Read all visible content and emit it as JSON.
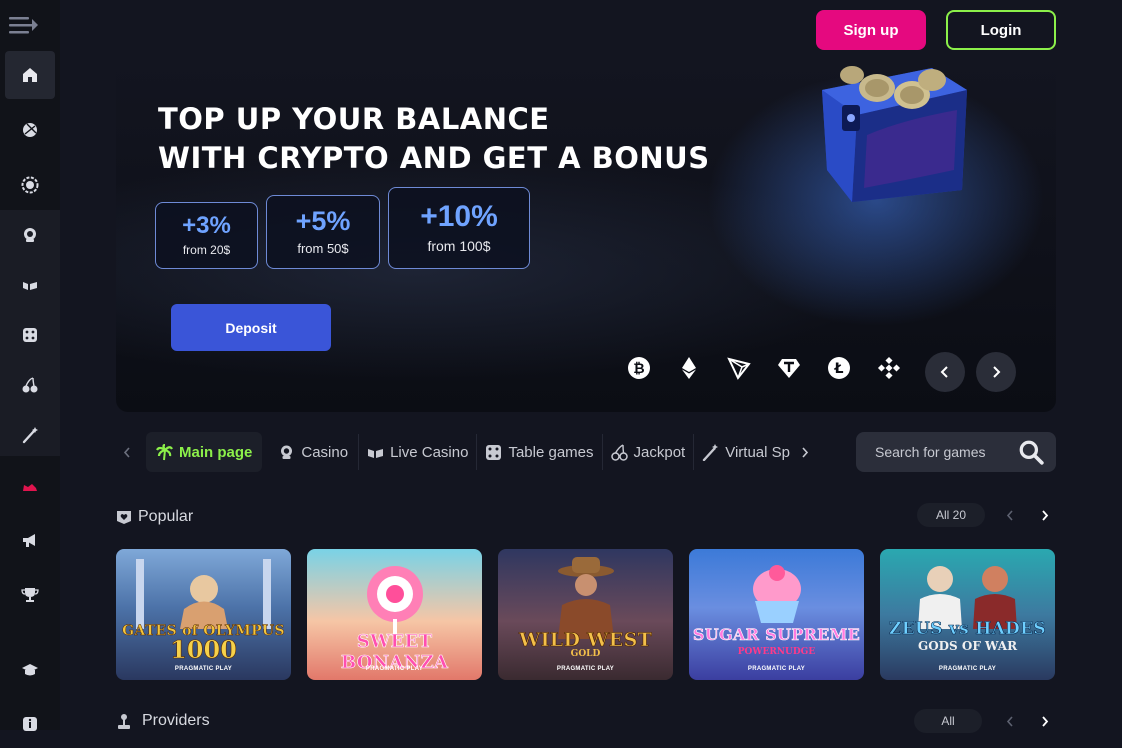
{
  "header": {
    "signup_label": "Sign up",
    "login_label": "Login"
  },
  "sidebar": {
    "items": [
      {
        "icon": "home-icon",
        "active": true
      },
      {
        "icon": "sports-ball-icon"
      },
      {
        "icon": "cyber-icon"
      },
      {
        "icon": "casino-icon"
      },
      {
        "icon": "live-casino-icon"
      },
      {
        "icon": "dice-icon"
      },
      {
        "icon": "cherry-icon"
      },
      {
        "icon": "wand-icon"
      },
      {
        "icon": "promo-shoe-icon"
      },
      {
        "icon": "megaphone-icon"
      },
      {
        "icon": "trophy-icon"
      },
      {
        "icon": "academy-icon"
      },
      {
        "icon": "info-icon"
      }
    ]
  },
  "banner": {
    "title_line1": "TOP UP YOUR BALANCE",
    "title_line2": "WITH CRYPTO AND GET A BONUS",
    "bonuses": [
      {
        "pct": "+3%",
        "from": "from 20$"
      },
      {
        "pct": "+5%",
        "from": "from 50$"
      },
      {
        "pct": "+10%",
        "from": "from 100$"
      }
    ],
    "deposit_label": "Deposit",
    "coins": [
      "bitcoin-icon",
      "ethereum-icon",
      "tron-icon",
      "tether-icon",
      "litecoin-icon",
      "binance-icon"
    ]
  },
  "tabs": [
    {
      "label": "Main page",
      "icon": "palm-icon",
      "active": true
    },
    {
      "label": "Casino",
      "icon": "casino-icon"
    },
    {
      "label": "Live Casino",
      "icon": "live-casino-icon"
    },
    {
      "label": "Table games",
      "icon": "dice-icon"
    },
    {
      "label": "Jackpot",
      "icon": "cherry-icon"
    },
    {
      "label": "Virtual Sp",
      "icon": "wand-icon"
    }
  ],
  "search": {
    "placeholder": "Search for games"
  },
  "popular": {
    "title": "Popular",
    "all_label": "All 20",
    "games": [
      {
        "name": "GATES of OLYMPUS",
        "sub": "1000",
        "provider": "PRAGMATIC PLAY"
      },
      {
        "name": "SWEET BONANZA",
        "sub": "",
        "provider": "PRAGMATIC PLAY"
      },
      {
        "name": "WILD WEST",
        "sub": "GOLD",
        "provider": "PRAGMATIC PLAY"
      },
      {
        "name": "SUGAR SUPREME",
        "sub": "POWERNUDGE",
        "provider": "PRAGMATIC PLAY"
      },
      {
        "name": "ZEUS vs HADES",
        "sub": "GODS OF WAR",
        "provider": "PRAGMATIC PLAY"
      }
    ]
  },
  "providers": {
    "title": "Providers",
    "all_label": "All"
  },
  "colors": {
    "accent_green": "#8cf04a",
    "signup_pink": "#e5097f",
    "deposit_blue": "#3a55d8",
    "bonus_blue": "#6fa3ff"
  }
}
